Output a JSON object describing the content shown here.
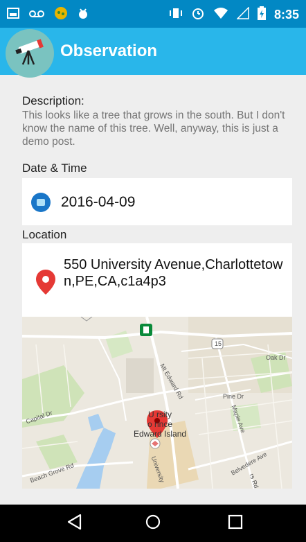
{
  "status_bar": {
    "time": "8:35"
  },
  "app_bar": {
    "title": "Observation",
    "logo_icon": "telescope-icon"
  },
  "description": {
    "label": "Description:",
    "text": "This looks like a tree that grows in the south. But I don't know the name of this tree. Well, anyway, this is just a demo post."
  },
  "date_time": {
    "label": "Date & Time",
    "value": "2016-04-09",
    "icon": "calendar-icon"
  },
  "location": {
    "label": "Location",
    "address": "550 University Avenue,Charlottetown,PE,CA,c1a4p3",
    "icon": "map-pin-icon"
  },
  "map": {
    "labels": {
      "mt_edward": "Mt Edward Rd",
      "oak": "Oak Dr",
      "pine": "Pine Dr",
      "capital": "Capital Dr",
      "maple": "Maple Ave",
      "beach_grove": "Beach Grove Rd",
      "belvedere": "Belvedere Ave",
      "university": "University",
      "route": "15",
      "poi_line1": "U    rsity",
      "poi_line2": "o     rince",
      "poi_line3": "Edward Island",
      "rs_rd": "rs Rd"
    }
  },
  "colors": {
    "status_bar": "#0288c4",
    "app_bar": "#29b6ea",
    "pin": "#e53935"
  }
}
